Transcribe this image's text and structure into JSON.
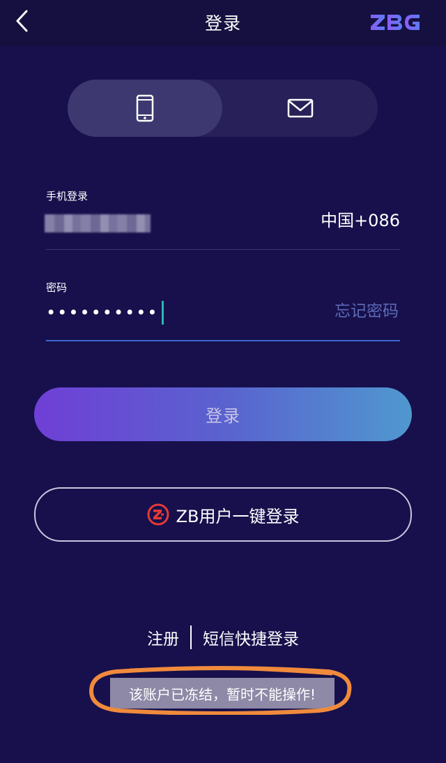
{
  "header": {
    "title": "登录",
    "back_icon": "chevron-left-icon",
    "brand": "ZBG"
  },
  "tabs": [
    {
      "id": "phone",
      "icon": "mobile-phone-icon",
      "selected": true
    },
    {
      "id": "email",
      "icon": "envelope-icon",
      "selected": false
    }
  ],
  "phone_field": {
    "label": "手机登录",
    "value_obscured": true,
    "country_code": "中国+086"
  },
  "password_field": {
    "label": "密码",
    "value_masked": "••••••••••",
    "forgot_label": "忘记密码"
  },
  "login_button": {
    "label": "登录"
  },
  "zb_login_button": {
    "label": "ZB用户一键登录",
    "icon": "zb-logo-icon"
  },
  "bottom_links": {
    "register": "注册",
    "sms_login": "短信快捷登录"
  },
  "toast": {
    "message": "该账户已冻结，暂时不能操作!"
  },
  "colors": {
    "background": "#17104c",
    "accent_start": "#6f3fd6",
    "accent_end": "#4f98cf",
    "brand_purple": "#7b5cff",
    "zb_red": "#e53935",
    "annotation_orange": "#f08a3c"
  }
}
